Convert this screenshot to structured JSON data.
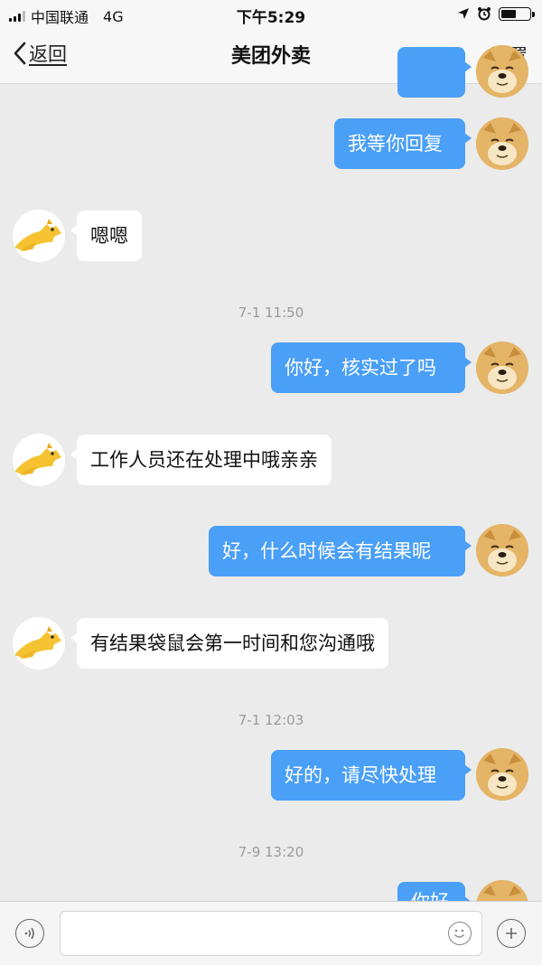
{
  "status_bar": {
    "carrier": "中国联通",
    "network": "4G",
    "time": "下午5:29",
    "battery_level": 0.55
  },
  "nav": {
    "back_label": "返回",
    "title": "美团外卖",
    "settings_label": "设置"
  },
  "messages": [
    {
      "type": "outgoing",
      "text": ""
    },
    {
      "type": "outgoing",
      "text": "我等你回复"
    },
    {
      "type": "incoming",
      "text": "嗯嗯"
    },
    {
      "type": "timestamp",
      "text": "7-1 11:50"
    },
    {
      "type": "outgoing",
      "text": "你好，核实过了吗"
    },
    {
      "type": "incoming",
      "text": "工作人员还在处理中哦亲亲"
    },
    {
      "type": "outgoing",
      "text": "好，什么时候会有结果昵"
    },
    {
      "type": "incoming",
      "text": "有结果袋鼠会第一时间和您沟通哦"
    },
    {
      "type": "timestamp",
      "text": "7-1 12:03"
    },
    {
      "type": "outgoing",
      "text": "好的，请尽快处理"
    },
    {
      "type": "timestamp",
      "text": "7-9 13:20"
    },
    {
      "type": "outgoing",
      "text": "你好"
    }
  ],
  "input_bar": {
    "text_value": "",
    "left_icon": "voice-icon",
    "emoji_icon": "emoji-icon",
    "add_icon": "plus-icon"
  },
  "colors": {
    "outgoing_bubble": "#4a9ff7",
    "incoming_bubble": "#ffffff",
    "background": "#ebebeb",
    "kangaroo_yellow": "#f5c332"
  }
}
